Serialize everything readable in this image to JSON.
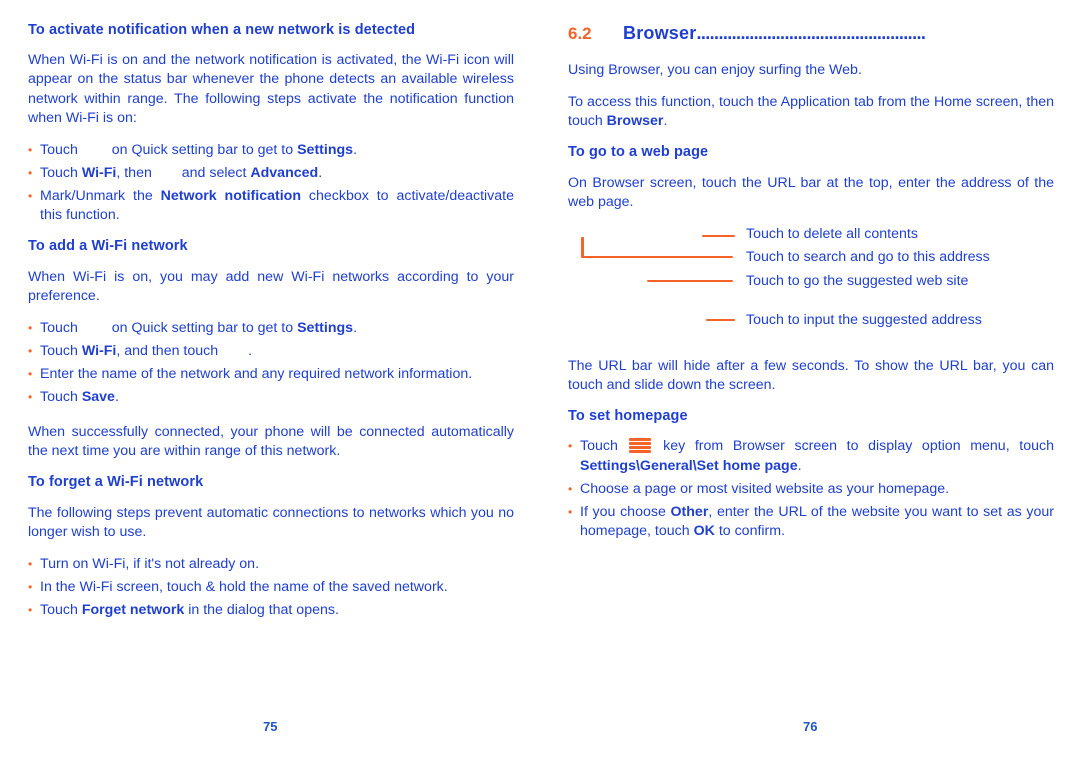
{
  "document": {
    "type": "user-manual-spread",
    "text_color": "#1f3fd0",
    "accent_color": "#f4642a"
  },
  "left_page": {
    "page_number": "75",
    "sections": [
      {
        "heading": "To activate notification when a new network is detected",
        "paragraph": "When Wi-Fi is on and the network notification is activated, the Wi-Fi icon will appear on the status bar whenever the phone detects an available wireless network within range. The following steps activate the notification function when Wi-Fi is on:",
        "bullets": [
          {
            "pre": "Touch ",
            "icon": "settings-icon-placeholder",
            "mid": " on Quick setting bar to get to ",
            "bold": "Settings",
            "post": "."
          },
          {
            "pre": "Touch ",
            "bold1": "Wi-Fi",
            "mid": ", then ",
            "icon": "overflow-icon-placeholder",
            "mid2": " and select ",
            "bold2": "Advanced",
            "post": "."
          },
          {
            "pre": "Mark/Unmark the ",
            "bold": "Network notification",
            "post": " checkbox to activate/deactivate this function."
          }
        ]
      },
      {
        "heading": "To add a Wi-Fi network",
        "paragraph": "When Wi-Fi is on, you may add new Wi-Fi networks according to your preference.",
        "bullets": [
          {
            "pre": "Touch ",
            "icon": "settings-icon-placeholder",
            "mid": " on Quick setting bar to get to ",
            "bold": "Settings",
            "post": "."
          },
          {
            "pre": "Touch ",
            "bold1": "Wi-Fi",
            "mid": ", and then touch ",
            "icon": "add-icon-placeholder",
            "post": "."
          },
          {
            "pre": "Enter the name of the network and any required network information."
          },
          {
            "pre": "Touch ",
            "bold": "Save",
            "post": "."
          }
        ],
        "trailing_paragraph": "When successfully connected, your phone will be connected automatically the next time you are within range of this network."
      },
      {
        "heading": "To forget a Wi-Fi network",
        "paragraph": "The following steps prevent automatic connections to networks which you no longer wish to use.",
        "bullets": [
          {
            "pre": "Turn on Wi-Fi, if it's not already on."
          },
          {
            "pre": "In the Wi-Fi screen, touch & hold the name of the saved network."
          },
          {
            "pre": "Touch ",
            "bold": "Forget network",
            "post": " in the dialog that opens."
          }
        ]
      }
    ]
  },
  "right_page": {
    "page_number": "76",
    "chapter": {
      "number": "6.2",
      "title": "Browser",
      "leader_dots": "...................................................."
    },
    "intro_paragraphs": [
      "Using Browser, you can enjoy surfing the Web."
    ],
    "access_paragraph": {
      "pre": "To access this function, touch the Application tab from the Home screen, then touch ",
      "bold": "Browser",
      "post": "."
    },
    "sections": [
      {
        "heading": "To go to a web page",
        "paragraph": "On Browser screen, touch the URL bar at the top, enter the address of the web page."
      }
    ],
    "callouts": [
      {
        "label": "Touch to delete all contents"
      },
      {
        "label": "Touch to search and go to this address"
      },
      {
        "label": "Touch to go the suggested web site"
      },
      {
        "label": "Touch to input the suggested address"
      }
    ],
    "url_bar_paragraph": "The URL bar will hide after a few seconds. To show the URL bar, you can touch and slide down the screen.",
    "homepage_section": {
      "heading": "To set homepage",
      "bullets": [
        {
          "pre": "Touch ",
          "icon": "menu-key-icon",
          "mid": " key from Browser screen to display option menu, touch ",
          "bold": "Settings\\General\\Set home page",
          "post": "."
        },
        {
          "pre": "Choose a page or most visited website as your homepage."
        },
        {
          "pre": "If you choose ",
          "bold1": "Other",
          "mid": ", enter the URL of the website you want to set as your homepage, touch ",
          "bold2": "OK",
          "post": " to confirm."
        }
      ]
    }
  }
}
